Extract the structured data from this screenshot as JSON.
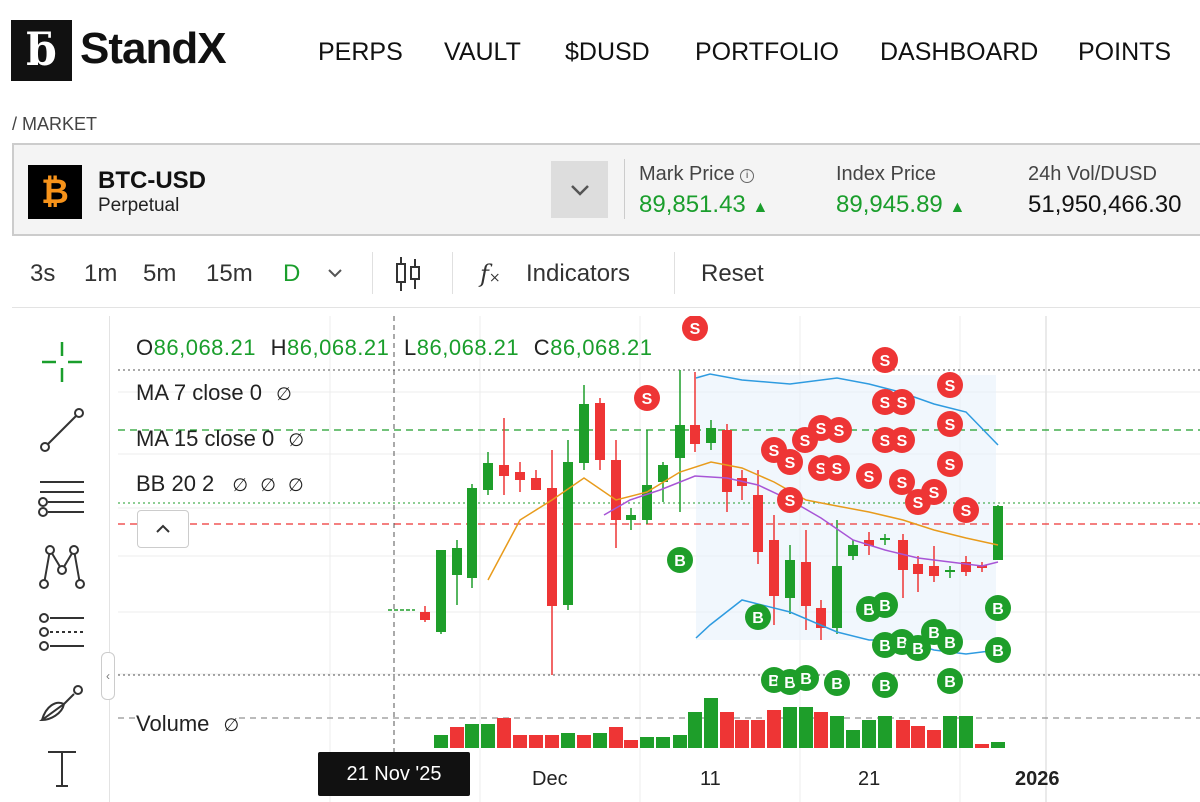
{
  "header": {
    "logo_glyph": "ƃ",
    "brand": "StandX",
    "nav": [
      "PERPS",
      "VAULT",
      "$DUSD",
      "PORTFOLIO",
      "DASHBOARD",
      "POINTS"
    ]
  },
  "breadcrumb": "/ MARKET",
  "market": {
    "icon_glyph": "₿",
    "pair": "BTC-USD",
    "type": "Perpetual",
    "mark_price_label": "Mark Price",
    "mark_price": "89,851.43",
    "index_price_label": "Index Price",
    "index_price": "89,945.89",
    "vol_label": "24h Vol/DUSD",
    "vol": "51,950,466.30",
    "up_color": "#1a9e2c"
  },
  "toolbar": {
    "timeframes": [
      "3s",
      "1m",
      "5m",
      "15m",
      "D"
    ],
    "active_timeframe": "D",
    "indicators_label": "Indicators",
    "reset_label": "Reset"
  },
  "chart_legend": {
    "o_label": "O",
    "o": "86,068.21",
    "h_label": "H",
    "h": "86,068.21",
    "l_label": "L",
    "l": "86,068.21",
    "c_label": "C",
    "c": "86,068.21",
    "ma7": "MA 7 close 0",
    "ma15": "MA 15 close 0",
    "bb": "BB 20 2",
    "volume": "Volume",
    "eye_glyph": "∅"
  },
  "chart_data": {
    "type": "candlestick",
    "x_ticks": [
      "Dec",
      "11",
      "21",
      "2026"
    ],
    "crosshair_date": "21 Nov '25",
    "colors": {
      "up": "#1e9e2a",
      "down": "#ee3535",
      "ma7": "#a855d6",
      "ma15": "#e89b1c",
      "bb": "#2e9be0"
    },
    "markers": {
      "buy": "B",
      "sell": "S"
    }
  }
}
